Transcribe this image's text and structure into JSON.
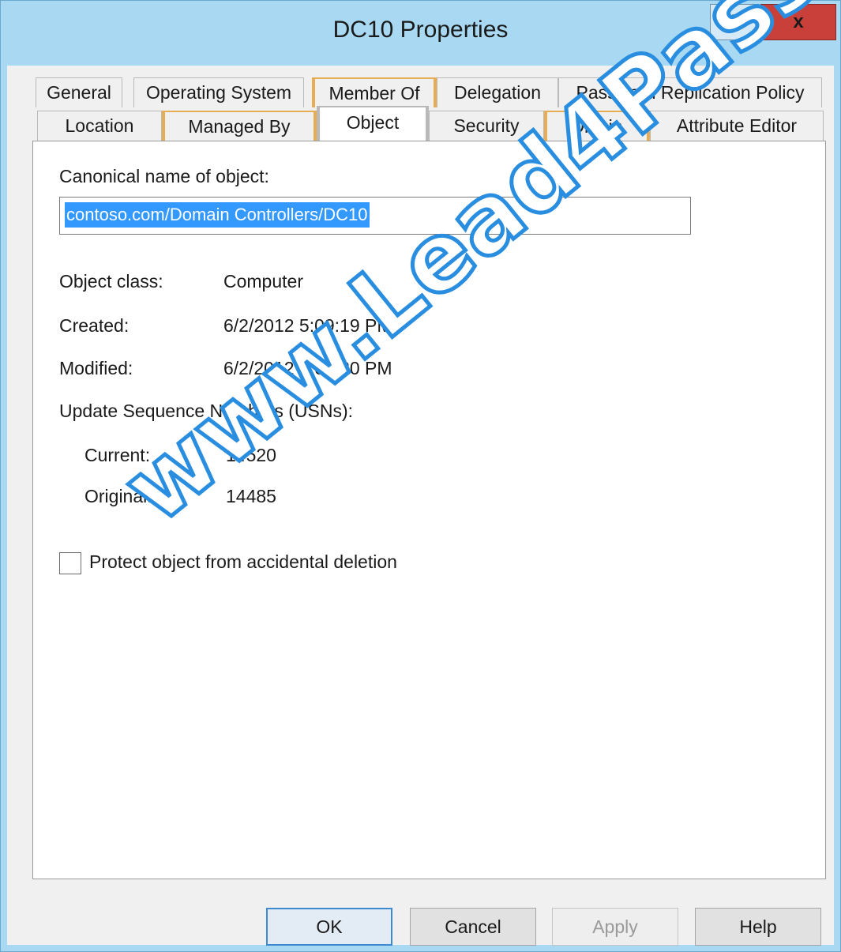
{
  "window": {
    "title": "DC10 Properties",
    "help_label": "?",
    "close_label": "x"
  },
  "tabs_row1": [
    "General",
    "Operating System",
    "Member Of",
    "Delegation",
    "Password Replication Policy"
  ],
  "tabs_row2": [
    "Location",
    "Managed By",
    "Object",
    "Security",
    "Dial-in",
    "Attribute Editor"
  ],
  "selected_tab": "Object",
  "object": {
    "canonical_label": "Canonical name of object:",
    "canonical_value": "contoso.com/Domain Controllers/DC10",
    "object_class_label": "Object class:",
    "object_class_value": "Computer",
    "created_label": "Created:",
    "created_value": "6/2/2012 5:09:19 PM",
    "modified_label": "Modified:",
    "modified_value": "6/2/2012 5:09:20 PM",
    "usn_label": "Update Sequence Numbers (USNs):",
    "current_label": "Current:",
    "current_value": "14520",
    "original_label": "Original:",
    "original_value": "14485",
    "protect_label": "Protect object from accidental deletion",
    "protect_checked": false
  },
  "buttons": {
    "ok": "OK",
    "cancel": "Cancel",
    "apply": "Apply",
    "help": "Help"
  },
  "watermark": "www.Lead4Pass.com",
  "colors": {
    "frame": "#a9d9f2",
    "close": "#c9403a",
    "selection": "#3399ff",
    "tab_accent": "#e6ad55",
    "watermark": "#2a8ee0"
  }
}
